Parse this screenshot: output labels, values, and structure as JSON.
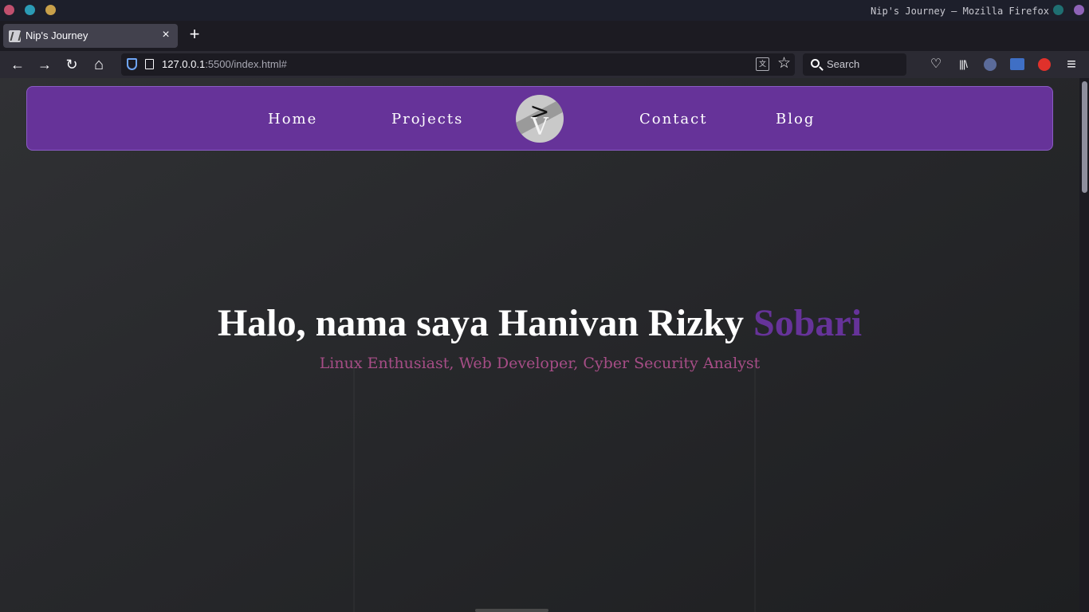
{
  "window": {
    "title": "Nip's Journey — Mozilla Firefox",
    "dots": [
      "#c0506e",
      "#2b9bb5",
      "#c8a04a"
    ],
    "right_dots": [
      "#1f6f72",
      "#8e63b8"
    ]
  },
  "tabs": [
    {
      "label": "Nip's Journey",
      "close": "×"
    }
  ],
  "new_tab": "+",
  "toolbar": {
    "back": "←",
    "forward": "→",
    "reload": "↻",
    "home": "⌂",
    "star": "☆",
    "translate": "文",
    "pocket": "♡",
    "library": "|||\\",
    "menu": "≡"
  },
  "url": {
    "host": "127.0.0.1",
    "rest": ":5500/index.html#"
  },
  "search": {
    "placeholder": "Search"
  },
  "site": {
    "nav": {
      "home": "Home",
      "projects": "Projects",
      "contact": "Contact",
      "blog": "Blog",
      "logo_top": ">",
      "logo_bottom": "V"
    },
    "hero": {
      "title_main": "Halo, nama saya Hanivan Rizky ",
      "title_accent": "Sobari",
      "subtitle": "Linux Enthusiast, Web Developer, Cyber Security Analyst"
    }
  },
  "colors": {
    "nav_bg": "#663399",
    "accent": "#663399",
    "subtitle": "#a64d86"
  }
}
